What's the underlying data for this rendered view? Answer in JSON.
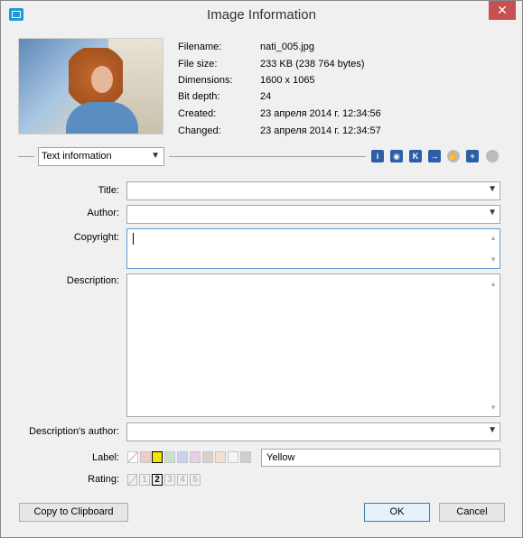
{
  "window": {
    "title": "Image Information",
    "close_glyph": "✕"
  },
  "file_info": [
    {
      "label": "Filename:",
      "value": "nati_005.jpg"
    },
    {
      "label": "File size:",
      "value": "233 KB (238 764 bytes)"
    },
    {
      "label": "Dimensions:",
      "value": "1600 x 1065"
    },
    {
      "label": "Bit depth:",
      "value": "24"
    },
    {
      "label": "Created:",
      "value": "23 апреля 2014 г. 12:34:56"
    },
    {
      "label": "Changed:",
      "value": "23 апреля 2014 г. 12:34:57"
    }
  ],
  "section": {
    "selected": "Text information"
  },
  "toolbar_icons": [
    "info-icon",
    "camera-icon",
    "keyword-icon",
    "arrow-icon",
    "hand-icon",
    "plus-icon",
    "globe-icon"
  ],
  "fields": {
    "title_label": "Title:",
    "title_value": "",
    "author_label": "Author:",
    "author_value": "",
    "copyright_label": "Copyright:",
    "copyright_value": "",
    "description_label": "Description:",
    "description_value": "",
    "description_author_label": "Description's author:",
    "description_author_value": ""
  },
  "label": {
    "caption": "Label:",
    "swatches": [
      "#ffffff",
      "#f2c9c9",
      "#f5e600",
      "#c9e3c9",
      "#c9cff2",
      "#e8cfe8",
      "#d9d0c9",
      "#ffffff",
      "#e0e0e0",
      "#cfcfcf"
    ],
    "selected_index": 2,
    "selected_name": "Yellow"
  },
  "rating": {
    "caption": "Rating:",
    "options": [
      "1",
      "2",
      "3",
      "4",
      "5"
    ],
    "selected": 2
  },
  "buttons": {
    "copy": "Copy to Clipboard",
    "ok": "OK",
    "cancel": "Cancel"
  }
}
